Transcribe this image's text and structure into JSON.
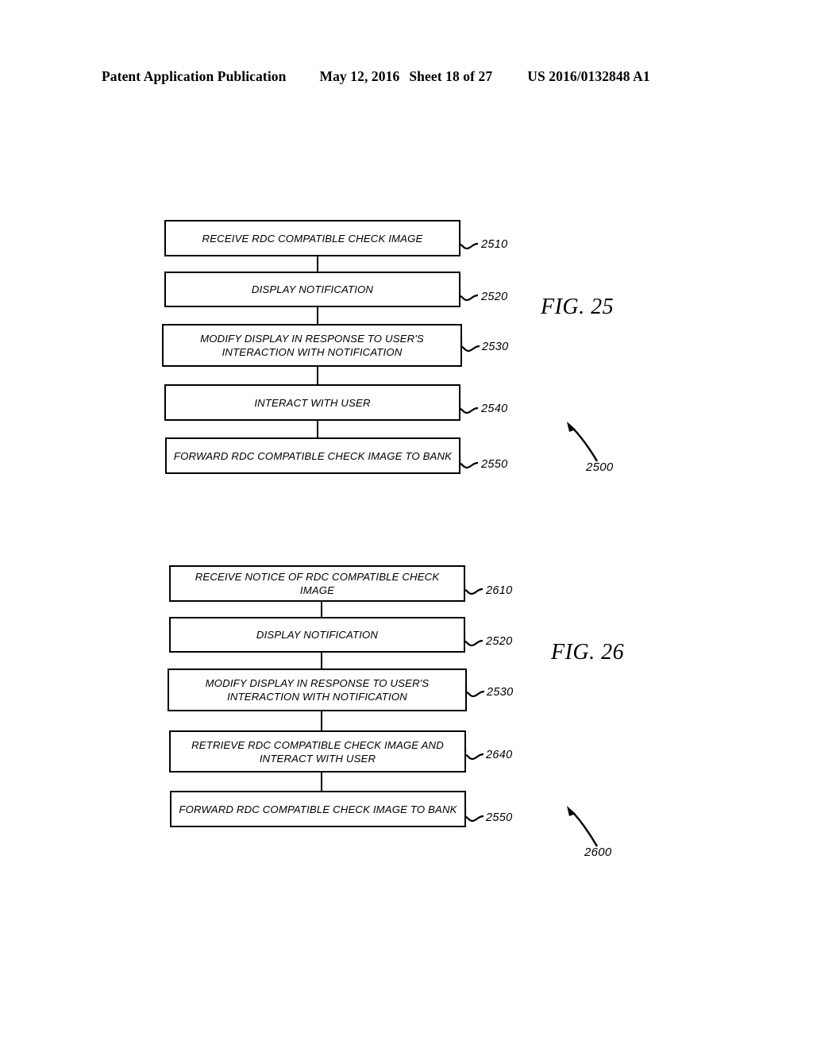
{
  "header": {
    "publication": "Patent Application Publication",
    "date": "May 12, 2016",
    "sheet": "Sheet 18 of 27",
    "patent_number": "US 2016/0132848 A1"
  },
  "figures": [
    {
      "title": "FIG. 25",
      "diagram_ref": "2500",
      "steps": [
        {
          "text": "RECEIVE RDC COMPATIBLE CHECK IMAGE",
          "ref": "2510"
        },
        {
          "text": "DISPLAY NOTIFICATION",
          "ref": "2520"
        },
        {
          "text": "MODIFY DISPLAY IN RESPONSE TO USER'S INTERACTION WITH NOTIFICATION",
          "ref": "2530"
        },
        {
          "text": "INTERACT WITH USER",
          "ref": "2540"
        },
        {
          "text": "FORWARD RDC COMPATIBLE CHECK IMAGE TO BANK",
          "ref": "2550"
        }
      ]
    },
    {
      "title": "FIG. 26",
      "diagram_ref": "2600",
      "steps": [
        {
          "text": "RECEIVE NOTICE OF RDC COMPATIBLE CHECK IMAGE",
          "ref": "2610"
        },
        {
          "text": "DISPLAY NOTIFICATION",
          "ref": "2520"
        },
        {
          "text": "MODIFY DISPLAY IN RESPONSE TO USER'S INTERACTION WITH NOTIFICATION",
          "ref": "2530"
        },
        {
          "text": "RETRIEVE RDC COMPATIBLE CHECK IMAGE AND INTERACT WITH USER",
          "ref": "2640"
        },
        {
          "text": "FORWARD RDC COMPATIBLE CHECK IMAGE TO BANK",
          "ref": "2550"
        }
      ]
    }
  ],
  "colors": {
    "ink": "#000000",
    "paper": "#ffffff"
  }
}
